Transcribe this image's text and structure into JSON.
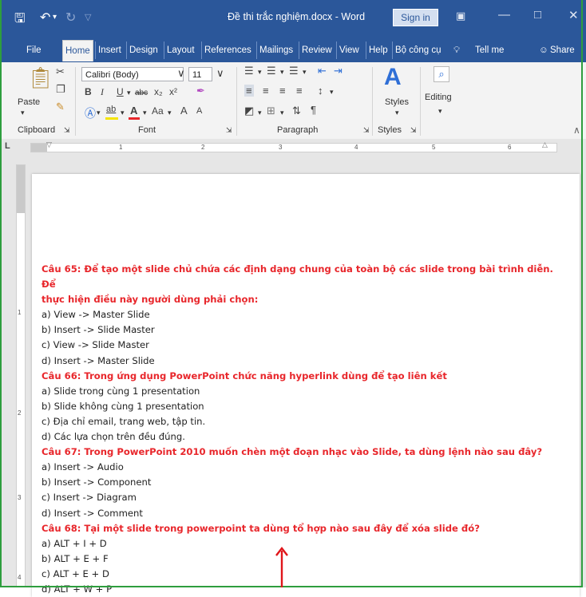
{
  "window": {
    "title": "Đề thi trắc nghiệm.docx  -  Word",
    "sign_in": "Sign in"
  },
  "tabs": [
    "File",
    "Home",
    "Insert",
    "Design",
    "Layout",
    "References",
    "Mailings",
    "Review",
    "View",
    "Help",
    "Bộ công cụ",
    "Tell me",
    "Share"
  ],
  "ribbon": {
    "clipboard": {
      "label": "Clipboard",
      "paste": "Paste"
    },
    "font": {
      "label": "Font",
      "family": "Calibri (Body)",
      "size": "11",
      "bold": "B",
      "italic": "I",
      "underline": "U",
      "strike": "abc",
      "subscript": "x₂",
      "superscript": "x²",
      "change_case": "Aa",
      "grow": "A",
      "shrink": "A",
      "font_color": "A",
      "highlight": "ab"
    },
    "paragraph": {
      "label": "Paragraph"
    },
    "styles": {
      "label": "Styles",
      "button": "Styles"
    },
    "editing": {
      "button": "Editing"
    }
  },
  "ruler": {
    "numbers": [
      "1",
      "2",
      "3",
      "4",
      "5",
      "6"
    ],
    "side_numbers": [
      "1",
      "2",
      "3",
      "4"
    ]
  },
  "document": {
    "lines": [
      {
        "kind": "q",
        "text": "Câu 65: Để tạo một slide chủ chứa các định dạng chung của toàn bộ các slide trong bài trình diễn. Để"
      },
      {
        "kind": "q",
        "text": "thực hiện điều này người dùng phải chọn:"
      },
      {
        "kind": "a",
        "text": "a) View -> Master Slide"
      },
      {
        "kind": "a",
        "text": "b) Insert -> Slide Master"
      },
      {
        "kind": "a",
        "text": "c) View -> Slide Master"
      },
      {
        "kind": "a",
        "text": "d) Insert -> Master Slide"
      },
      {
        "kind": "q",
        "text": "Câu 66: Trong ứng dụng PowerPoint chức năng hyperlink dùng để tạo liên kết"
      },
      {
        "kind": "a",
        "text": "a) Slide trong cùng 1 presentation"
      },
      {
        "kind": "a",
        "text": "b) Slide không cùng 1 presentation"
      },
      {
        "kind": "a",
        "text": "c) Địa chỉ email, trang web, tập tin."
      },
      {
        "kind": "a",
        "text": "d) Các lựa chọn trên đều đúng."
      },
      {
        "kind": "q",
        "text": "Câu 67: Trong PowerPoint 2010 muốn chèn một đoạn nhạc vào Slide, ta dùng lệnh nào sau đây?"
      },
      {
        "kind": "a",
        "text": "a) Insert -> Audio"
      },
      {
        "kind": "a",
        "text": "b) Insert -> Component"
      },
      {
        "kind": "a",
        "text": "c) Insert -> Diagram"
      },
      {
        "kind": "a",
        "text": "d) Insert -> Comment"
      },
      {
        "kind": "q",
        "text": "Câu 68: Tại một slide trong powerpoint ta dùng tổ hợp nào sau đây để xóa slide đó?"
      },
      {
        "kind": "a",
        "text": "a) ALT + I + D"
      },
      {
        "kind": "a",
        "text": "b) ALT + E + F"
      },
      {
        "kind": "a",
        "text": "c) ALT + E + D"
      },
      {
        "kind": "a",
        "text": "d) ALT + W + P"
      }
    ]
  },
  "colors": {
    "titlebar": "#2b579a",
    "question_text": "#e8262b",
    "answer_text": "#222222",
    "annotation_arrow": "#e0161b",
    "frame_border": "#2e9e3e"
  }
}
